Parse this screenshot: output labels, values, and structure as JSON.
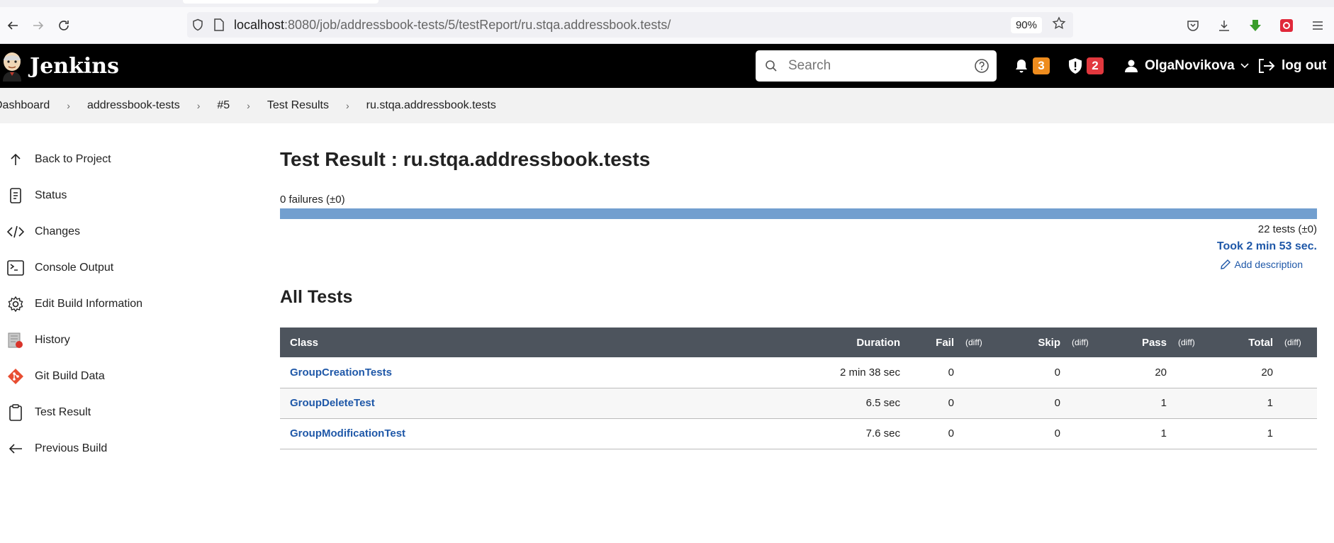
{
  "browser": {
    "url_host": "localhost",
    "url_rest": ":8080/job/addressbook-tests/5/testReport/ru.stqa.addressbook.tests/",
    "zoom": "90%"
  },
  "header": {
    "brand": "Jenkins",
    "search_placeholder": "Search",
    "notifications_count": "3",
    "security_count": "2",
    "user": "OlgaNovikova",
    "logout": "log out"
  },
  "breadcrumb": [
    "Dashboard",
    "addressbook-tests",
    "#5",
    "Test Results",
    "ru.stqa.addressbook.tests"
  ],
  "sidebar": [
    {
      "label": "Back to Project",
      "icon": "arrow-up-icon"
    },
    {
      "label": "Status",
      "icon": "document-icon"
    },
    {
      "label": "Changes",
      "icon": "code-icon"
    },
    {
      "label": "Console Output",
      "icon": "terminal-icon"
    },
    {
      "label": "Edit Build Information",
      "icon": "gear-icon"
    },
    {
      "label": "History",
      "icon": "history-icon"
    },
    {
      "label": "Git Build Data",
      "icon": "git-icon"
    },
    {
      "label": "Test Result",
      "icon": "clipboard-icon"
    },
    {
      "label": "Previous Build",
      "icon": "arrow-left-icon"
    }
  ],
  "main": {
    "title": "Test Result : ru.stqa.addressbook.tests",
    "failures": "0 failures (±0)",
    "fail_fraction": 0,
    "totals": "22 tests (±0)",
    "took": "Took 2 min 53 sec.",
    "add_description": "Add description",
    "section_title": "All Tests"
  },
  "table": {
    "headers": {
      "class": "Class",
      "duration": "Duration",
      "fail": "Fail",
      "skip": "Skip",
      "pass": "Pass",
      "total": "Total",
      "diff": "(diff)"
    },
    "rows": [
      {
        "class": "GroupCreationTests",
        "duration": "2 min 38 sec",
        "fail": "0",
        "skip": "0",
        "pass": "20",
        "total": "20"
      },
      {
        "class": "GroupDeleteTest",
        "duration": "6.5 sec",
        "fail": "0",
        "skip": "0",
        "pass": "1",
        "total": "1"
      },
      {
        "class": "GroupModificationTest",
        "duration": "7.6 sec",
        "fail": "0",
        "skip": "0",
        "pass": "1",
        "total": "1"
      }
    ]
  },
  "colors": {
    "header_bg": "#000000",
    "table_header_bg": "#4d545d",
    "progress_bar": "#729fcf",
    "link": "#1f58a8"
  }
}
